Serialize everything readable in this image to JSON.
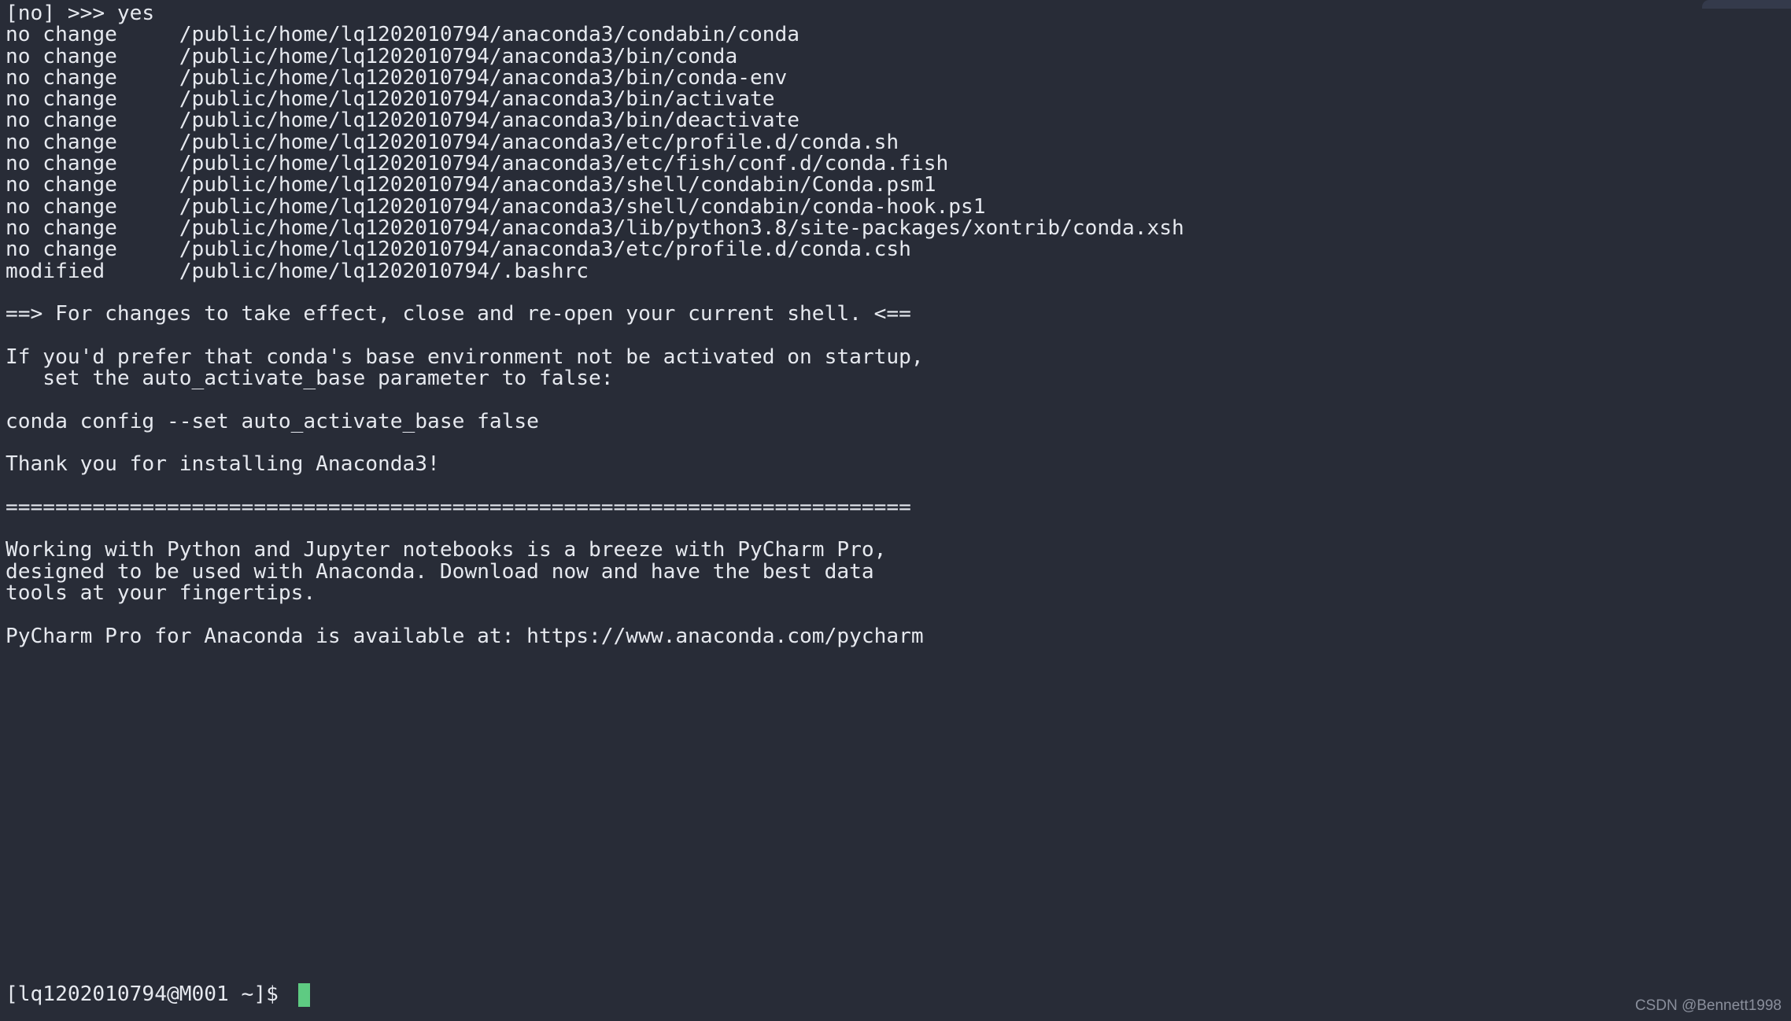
{
  "terminal": {
    "background_color": "#282c37",
    "foreground_color": "#e6e9ef",
    "cursor_color": "#5ecb82",
    "titlebar_color": "#343a4b",
    "lines": [
      "[no] >>> yes",
      "no change     /public/home/lq1202010794/anaconda3/condabin/conda",
      "no change     /public/home/lq1202010794/anaconda3/bin/conda",
      "no change     /public/home/lq1202010794/anaconda3/bin/conda-env",
      "no change     /public/home/lq1202010794/anaconda3/bin/activate",
      "no change     /public/home/lq1202010794/anaconda3/bin/deactivate",
      "no change     /public/home/lq1202010794/anaconda3/etc/profile.d/conda.sh",
      "no change     /public/home/lq1202010794/anaconda3/etc/fish/conf.d/conda.fish",
      "no change     /public/home/lq1202010794/anaconda3/shell/condabin/Conda.psm1",
      "no change     /public/home/lq1202010794/anaconda3/shell/condabin/conda-hook.ps1",
      "no change     /public/home/lq1202010794/anaconda3/lib/python3.8/site-packages/xontrib/conda.xsh",
      "no change     /public/home/lq1202010794/anaconda3/etc/profile.d/conda.csh",
      "modified      /public/home/lq1202010794/.bashrc",
      "",
      "==> For changes to take effect, close and re-open your current shell. <==",
      "",
      "If you'd prefer that conda's base environment not be activated on startup,",
      "   set the auto_activate_base parameter to false:",
      "",
      "conda config --set auto_activate_base false",
      "",
      "Thank you for installing Anaconda3!",
      "",
      "=========================================================================",
      "",
      "Working with Python and Jupyter notebooks is a breeze with PyCharm Pro,",
      "designed to be used with Anaconda. Download now and have the best data",
      "tools at your fingertips.",
      "",
      "PyCharm Pro for Anaconda is available at: https://www.anaconda.com/pycharm",
      ""
    ],
    "prompt": {
      "text": "[lq1202010794@M001 ~]$ ",
      "user": "lq1202010794",
      "host": "M001",
      "cwd": "~",
      "symbol": "$",
      "cursor": "block"
    }
  },
  "watermark": {
    "text": "CSDN @Bennett1998"
  }
}
